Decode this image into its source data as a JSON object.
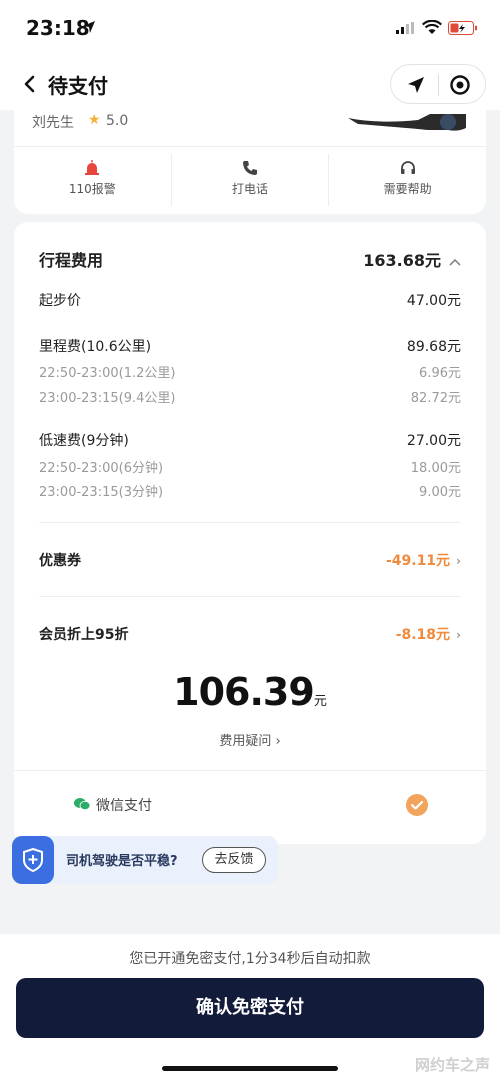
{
  "status_bar": {
    "time": "23:18"
  },
  "nav": {
    "title": "待支付"
  },
  "driver": {
    "name": "刘先生",
    "rating": "5.0",
    "actions": [
      {
        "label": "110报警",
        "icon": "alarm-icon"
      },
      {
        "label": "打电话",
        "icon": "phone-icon"
      },
      {
        "label": "需要帮助",
        "icon": "headset-icon"
      }
    ]
  },
  "fee": {
    "title": "行程费用",
    "total": "163.68元",
    "base": {
      "label": "起步价",
      "value": "47.00元"
    },
    "mileage": {
      "label": "里程费(10.6公里)",
      "value": "89.68元",
      "items": [
        {
          "label": "22:50-23:00(1.2公里)",
          "value": "6.96元"
        },
        {
          "label": "23:00-23:15(9.4公里)",
          "value": "82.72元"
        }
      ]
    },
    "low_speed": {
      "label": "低速费(9分钟)",
      "value": "27.00元",
      "items": [
        {
          "label": "22:50-23:00(6分钟)",
          "value": "18.00元"
        },
        {
          "label": "23:00-23:15(3分钟)",
          "value": "9.00元"
        }
      ]
    },
    "coupon": {
      "label": "优惠券",
      "value": "-49.11元"
    },
    "member": {
      "label": "会员折上95折",
      "value": "-8.18元"
    },
    "pay_amount": "106.39",
    "pay_unit": "元",
    "question": "费用疑问",
    "payment_method": "微信支付"
  },
  "feedback": {
    "question": "司机驾驶是否平稳?",
    "button": "去反馈"
  },
  "bottom": {
    "notice": "您已开通免密支付,1分34秒后自动扣款",
    "confirm": "确认免密支付",
    "watermark": "网约车之声"
  },
  "colors": {
    "accent_orange": "#f08a3c",
    "confirm_bg": "#131b3a",
    "wechat_green": "#2aae67",
    "shield_blue": "#3b6ee0"
  }
}
